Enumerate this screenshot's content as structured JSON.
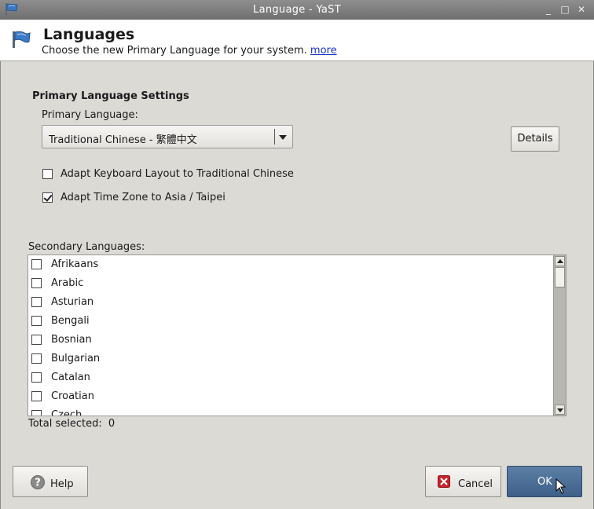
{
  "window": {
    "title": "Language - YaST",
    "controls": {
      "minimize": "_",
      "maximize": "□",
      "close": "✕"
    }
  },
  "header": {
    "title": "Languages",
    "subtitle": "Choose the new Primary Language for your system.",
    "more_link": "more"
  },
  "primary": {
    "section_title": "Primary Language Settings",
    "label": "Primary Language:",
    "selected": "Traditional Chinese - 繁體中文",
    "details_button": "Details",
    "adapt_keyboard": {
      "label": "Adapt Keyboard Layout to Traditional Chinese",
      "checked": false
    },
    "adapt_timezone": {
      "label": "Adapt Time Zone to Asia / Taipei",
      "checked": true
    }
  },
  "secondary": {
    "label": "Secondary Languages:",
    "items": [
      "Afrikaans",
      "Arabic",
      "Asturian",
      "Bengali",
      "Bosnian",
      "Bulgarian",
      "Catalan",
      "Croatian",
      "Czech"
    ],
    "total_label": "Total selected:",
    "total_count": "0"
  },
  "buttons": {
    "help": "Help",
    "cancel": "Cancel",
    "ok": "OK"
  },
  "colors": {
    "ok_button": "#4a6c94",
    "link": "#1a35c8",
    "cancel_icon": "#c8232c"
  },
  "icons": {
    "window": "flag-icon",
    "header": "flag-icon",
    "help": "question-icon",
    "cancel": "cancel-x-icon"
  }
}
